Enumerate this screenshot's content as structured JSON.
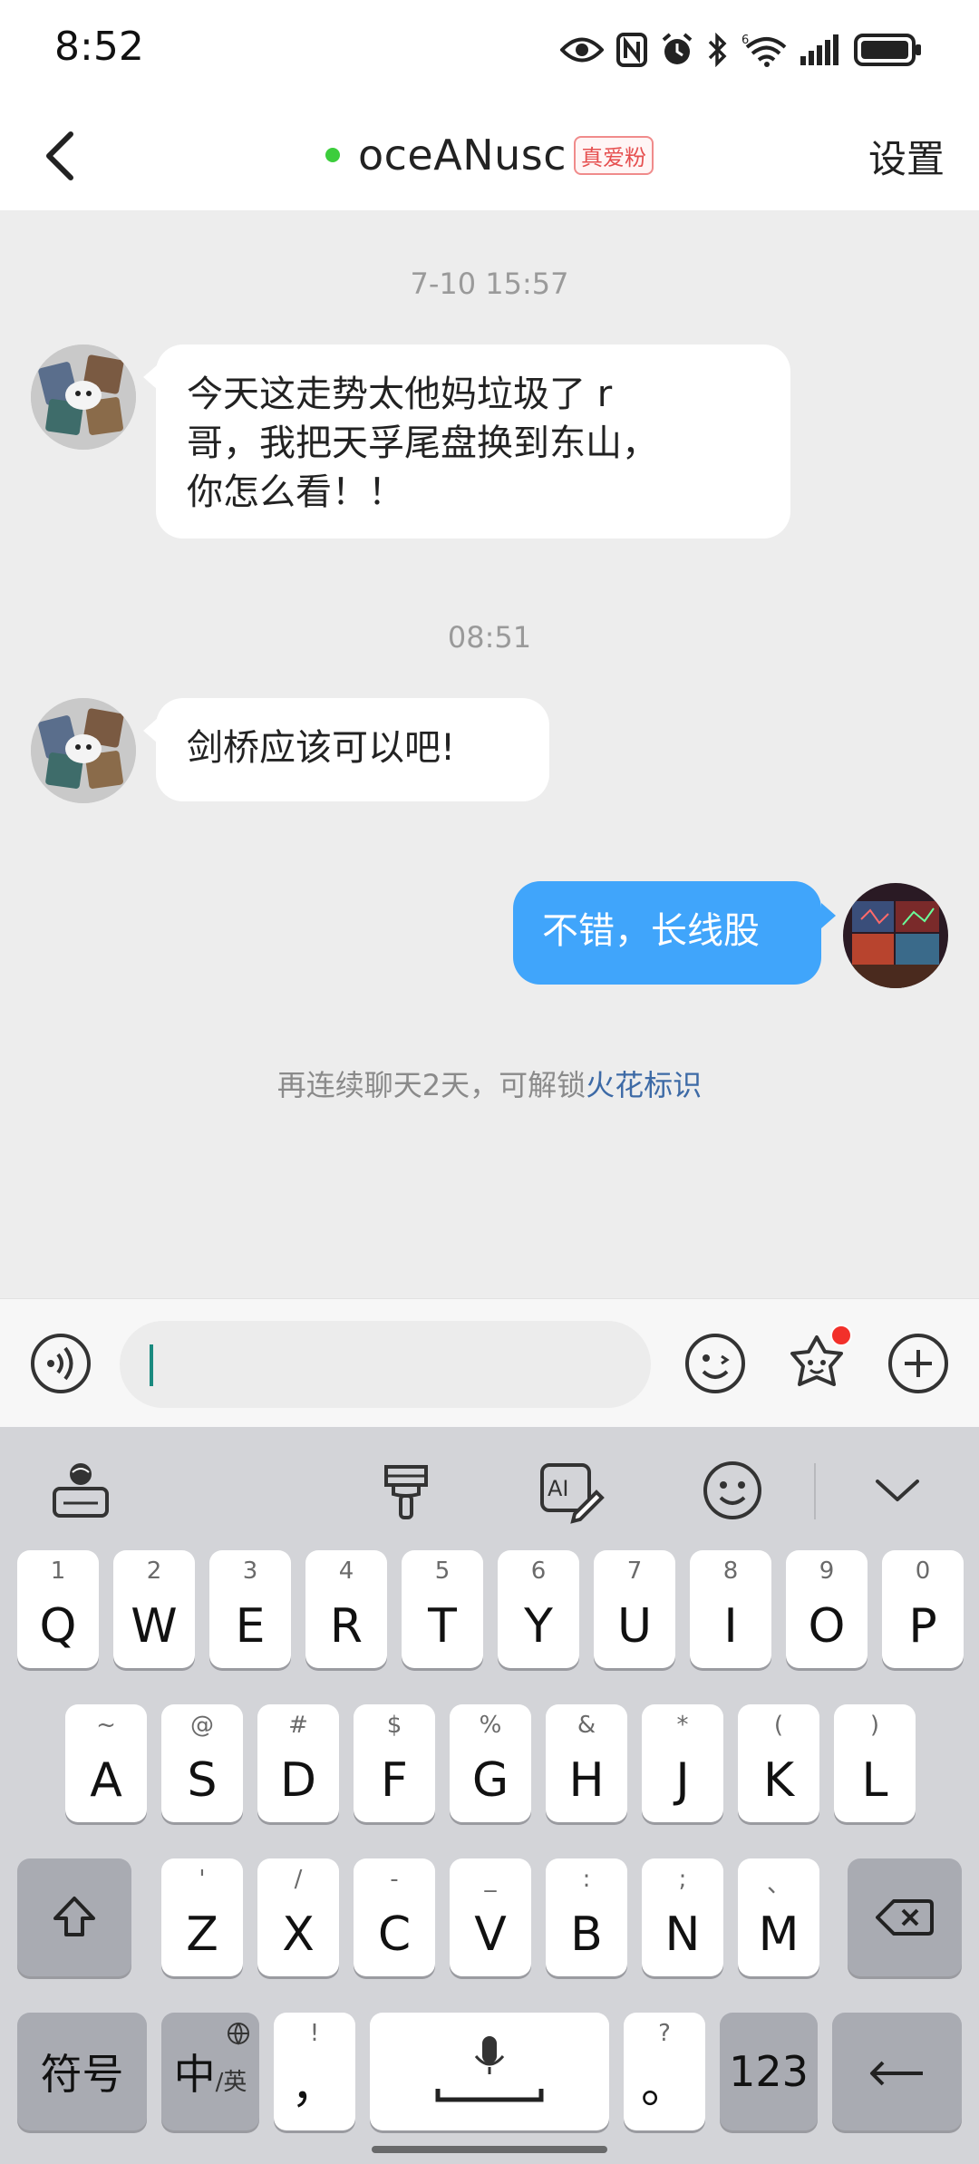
{
  "status_bar": {
    "time": "8:52",
    "icons": [
      "eye-icon",
      "nfc-icon",
      "alarm-icon",
      "bluetooth-icon",
      "wifi-6-icon",
      "signal-icon",
      "battery-icon"
    ],
    "wifi_label": "6"
  },
  "header": {
    "back_icon": "chevron-left-icon",
    "title": "oceANusc",
    "badge": "真爱粉",
    "settings_label": "设置",
    "online_color": "#3ccd3c"
  },
  "chat": {
    "messages": [
      {
        "timestamp": "7-10 15:57",
        "sender": "other",
        "lines": [
          "今天这走势太他妈垃圾了 r",
          "哥，我把天孚尾盘换到东山，",
          "你怎么看！！"
        ]
      },
      {
        "timestamp": "08:51",
        "sender": "other",
        "lines": [
          "剑桥应该可以吧!"
        ]
      },
      {
        "timestamp": "",
        "sender": "self",
        "lines": [
          "不错，长线股"
        ]
      }
    ],
    "hint_text": "再连续聊天2天，可解锁",
    "hint_link": "火花标识"
  },
  "input_bar": {
    "placeholder": "",
    "icons": [
      "voice-icon",
      "emoji-icon",
      "sticker-icon",
      "plus-icon"
    ]
  },
  "keyboard": {
    "toolbar_icons": [
      "keyboard-globe-icon",
      "brush-icon",
      "ai-write-icon",
      "emoji-icon",
      "collapse-icon"
    ],
    "row1": [
      {
        "sub": "1",
        "main": "Q"
      },
      {
        "sub": "2",
        "main": "W"
      },
      {
        "sub": "3",
        "main": "E"
      },
      {
        "sub": "4",
        "main": "R"
      },
      {
        "sub": "5",
        "main": "T"
      },
      {
        "sub": "6",
        "main": "Y"
      },
      {
        "sub": "7",
        "main": "U"
      },
      {
        "sub": "8",
        "main": "I"
      },
      {
        "sub": "9",
        "main": "O"
      },
      {
        "sub": "0",
        "main": "P"
      }
    ],
    "row2": [
      {
        "sub": "~",
        "main": "A"
      },
      {
        "sub": "@",
        "main": "S"
      },
      {
        "sub": "#",
        "main": "D"
      },
      {
        "sub": "$",
        "main": "F"
      },
      {
        "sub": "%",
        "main": "G"
      },
      {
        "sub": "&",
        "main": "H"
      },
      {
        "sub": "*",
        "main": "J"
      },
      {
        "sub": "(",
        "main": "K"
      },
      {
        "sub": ")",
        "main": "L"
      }
    ],
    "row3": [
      {
        "sub": "'",
        "main": "Z"
      },
      {
        "sub": "/",
        "main": "X"
      },
      {
        "sub": "-",
        "main": "C"
      },
      {
        "sub": "_",
        "main": "V"
      },
      {
        "sub": ":",
        "main": "B"
      },
      {
        "sub": ";",
        "main": "N"
      },
      {
        "sub": "、",
        "main": "M"
      }
    ],
    "symbols_label": "符号",
    "lang_main": "中",
    "lang_sub": "/英",
    "comma_sub": "!",
    "comma_main": "，",
    "period_sub": "?",
    "period_main": "。",
    "num_label": "123"
  }
}
